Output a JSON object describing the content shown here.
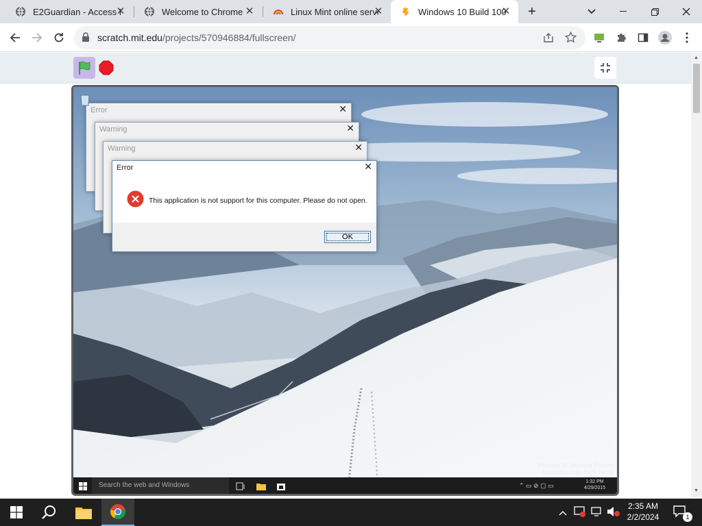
{
  "browser": {
    "tabs": [
      {
        "label": "E2Guardian - Access De",
        "icon": "e2guardian-globe-icon"
      },
      {
        "label": "Welcome to Chrome",
        "icon": "globe-icon"
      },
      {
        "label": "Linux Mint online serve",
        "icon": "rainbow-icon"
      },
      {
        "label": "Windows 10 Build 100",
        "icon": "scratch-logo-icon"
      }
    ],
    "active_tab": 3,
    "url_host": "scratch.mit.edu",
    "url_path": "/projects/570946884/fullscreen/"
  },
  "stage": {
    "dialogs": [
      {
        "title": "Error"
      },
      {
        "title": "Warning"
      },
      {
        "title": "Warning"
      },
      {
        "title": "Error",
        "message": "This application is not support for this computer. Please do not open.",
        "button": "OK"
      }
    ],
    "win_search_placeholder": "Search the web and Windows",
    "watermark_line1": "Windows 10 Technical Preview",
    "watermark_line2": "Evaluation copy. Build 10074",
    "win_time": "1:32 PM",
    "win_date": "4/29/2015"
  },
  "taskbar": {
    "time": "2:35 AM",
    "date": "2/2/2024",
    "notification_count": "1"
  },
  "colors": {
    "error_red": "#e23b2e",
    "flag_green": "#4cbf56",
    "stop_red": "#ec1c24"
  }
}
